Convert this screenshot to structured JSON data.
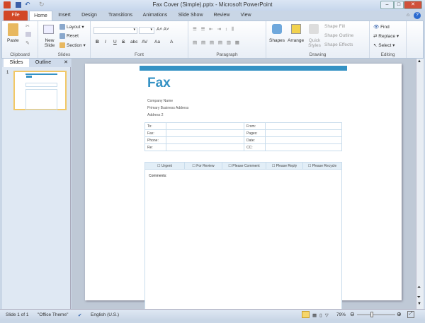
{
  "window": {
    "title": "Fax Cover (Simple).pptx - Microsoft PowerPoint"
  },
  "tabs": [
    "File",
    "Home",
    "Insert",
    "Design",
    "Transitions",
    "Animations",
    "Slide Show",
    "Review",
    "View"
  ],
  "ribbon": {
    "clipboard": {
      "label": "Clipboard",
      "paste": "Paste"
    },
    "slides": {
      "label": "Slides",
      "new_slide": "New Slide",
      "layout": "Layout",
      "reset": "Reset",
      "section": "Section"
    },
    "font": {
      "label": "Font",
      "bold": "B",
      "italic": "I",
      "underline": "U",
      "strike": "S",
      "abc": "abc",
      "av": "AV",
      "aa": "Aa",
      "a": "A"
    },
    "paragraph": {
      "label": "Paragraph"
    },
    "drawing": {
      "label": "Drawing",
      "shapes": "Shapes",
      "arrange": "Arrange",
      "quick_styles": "Quick Styles",
      "shape_fill": "Shape Fill",
      "shape_outline": "Shape Outline",
      "shape_effects": "Shape Effects"
    },
    "editing": {
      "label": "Editing",
      "find": "Find",
      "replace": "Replace",
      "select": "Select"
    }
  },
  "pane": {
    "tabs": [
      "Slides",
      "Outline"
    ],
    "slide_number": "1"
  },
  "slide": {
    "title": "Fax",
    "address": [
      "Company  Name",
      "Primary  Business  Address",
      "Address  2"
    ],
    "fields_left": [
      "To:",
      "Fax:",
      "Phone:",
      "Re:"
    ],
    "fields_right": [
      "From:",
      "Pages:",
      "Date:",
      "CC:"
    ],
    "checkboxes": [
      "Urgent",
      "For Review",
      "Please Comment",
      "Please Reply",
      "Please Recycle"
    ],
    "comments_label": "Comments:",
    "accent": "#3592c4"
  },
  "status": {
    "slide": "Slide 1 of 1",
    "theme": "\"Office Theme\"",
    "language": "English (U.S.)",
    "zoom": "79%",
    "zoom_value": 79
  }
}
